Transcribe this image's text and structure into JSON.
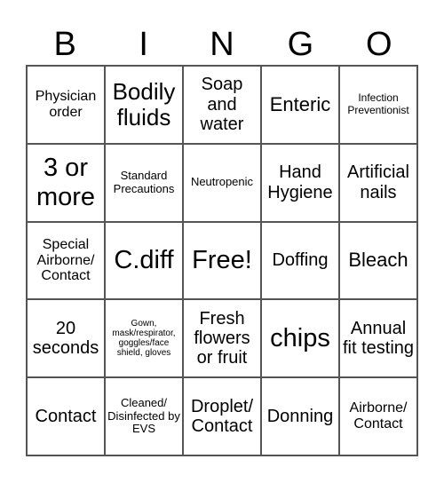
{
  "header": {
    "letters": [
      "B",
      "I",
      "N",
      "G",
      "O"
    ]
  },
  "cells": [
    [
      "Physician order",
      "Bodily fluids",
      "Soap and water",
      "Enteric",
      "Infection Preventionist"
    ],
    [
      "3 or more",
      "Standard Precautions",
      "Neutropenic",
      "Hand Hygiene",
      "Artificial nails"
    ],
    [
      "Special Airborne/ Contact",
      "C.diff",
      "Free!",
      "Doffing",
      "Bleach"
    ],
    [
      "20 seconds",
      "Gown, mask/respirator, goggles/face shield, gloves",
      "Fresh flowers or fruit",
      "chips",
      "Annual fit testing"
    ],
    [
      "Contact",
      "Cleaned/ Disinfected by EVS",
      "Droplet/ Contact",
      "Donning",
      "Airborne/ Contact"
    ]
  ],
  "colors": {
    "text": "#000000",
    "grid_line": "#555555",
    "background": "#ffffff"
  }
}
